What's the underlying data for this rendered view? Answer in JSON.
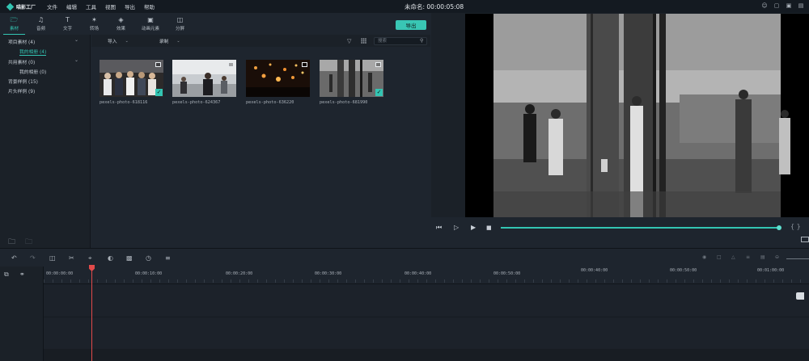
{
  "menubar": {
    "logo_text": "喵影工厂",
    "items": [
      "文件",
      "编辑",
      "工具",
      "视图",
      "导出",
      "帮助"
    ],
    "doc_title": "未命名: 00:00:05:08"
  },
  "tools": [
    {
      "label": "素材",
      "icon": "folder-icon"
    },
    {
      "label": "音频",
      "icon": "music-note-icon"
    },
    {
      "label": "文字",
      "icon": "text-icon"
    },
    {
      "label": "转场",
      "icon": "transition-icon"
    },
    {
      "label": "效果",
      "icon": "effects-icon"
    },
    {
      "label": "动画元素",
      "icon": "elements-icon"
    },
    {
      "label": "分屏",
      "icon": "split-screen-icon"
    }
  ],
  "export_label": "导出",
  "sidebar": {
    "items": [
      {
        "label": "项目素材 (4)"
      },
      {
        "label": "我的相册 (4)"
      },
      {
        "label": "共用素材 (0)"
      },
      {
        "label": "我的相册 (0)"
      },
      {
        "label": "背景样例 (15)"
      },
      {
        "label": "片头样例 (9)"
      }
    ]
  },
  "media_bar": {
    "import_label": "导入",
    "record_label": "录制",
    "search_placeholder": "搜索"
  },
  "media": [
    {
      "name": "pexels-photo-618116"
    },
    {
      "name": "pexels-photo-624367"
    },
    {
      "name": "pexels-photo-636220"
    },
    {
      "name": "pexels-photo-681990"
    }
  ],
  "timeline": {
    "ticks": [
      "00:00:00:00",
      "00:00:10:00",
      "00:00:20:00",
      "00:00:30:00",
      "00:00:40:00",
      "00:00:50:00",
      "00:00:40:00",
      "00:00:50:00",
      "00:01:00:00"
    ]
  },
  "colors": {
    "accent": "#33c5b3",
    "playhead": "#e24a4a",
    "background": "#1e252e"
  }
}
